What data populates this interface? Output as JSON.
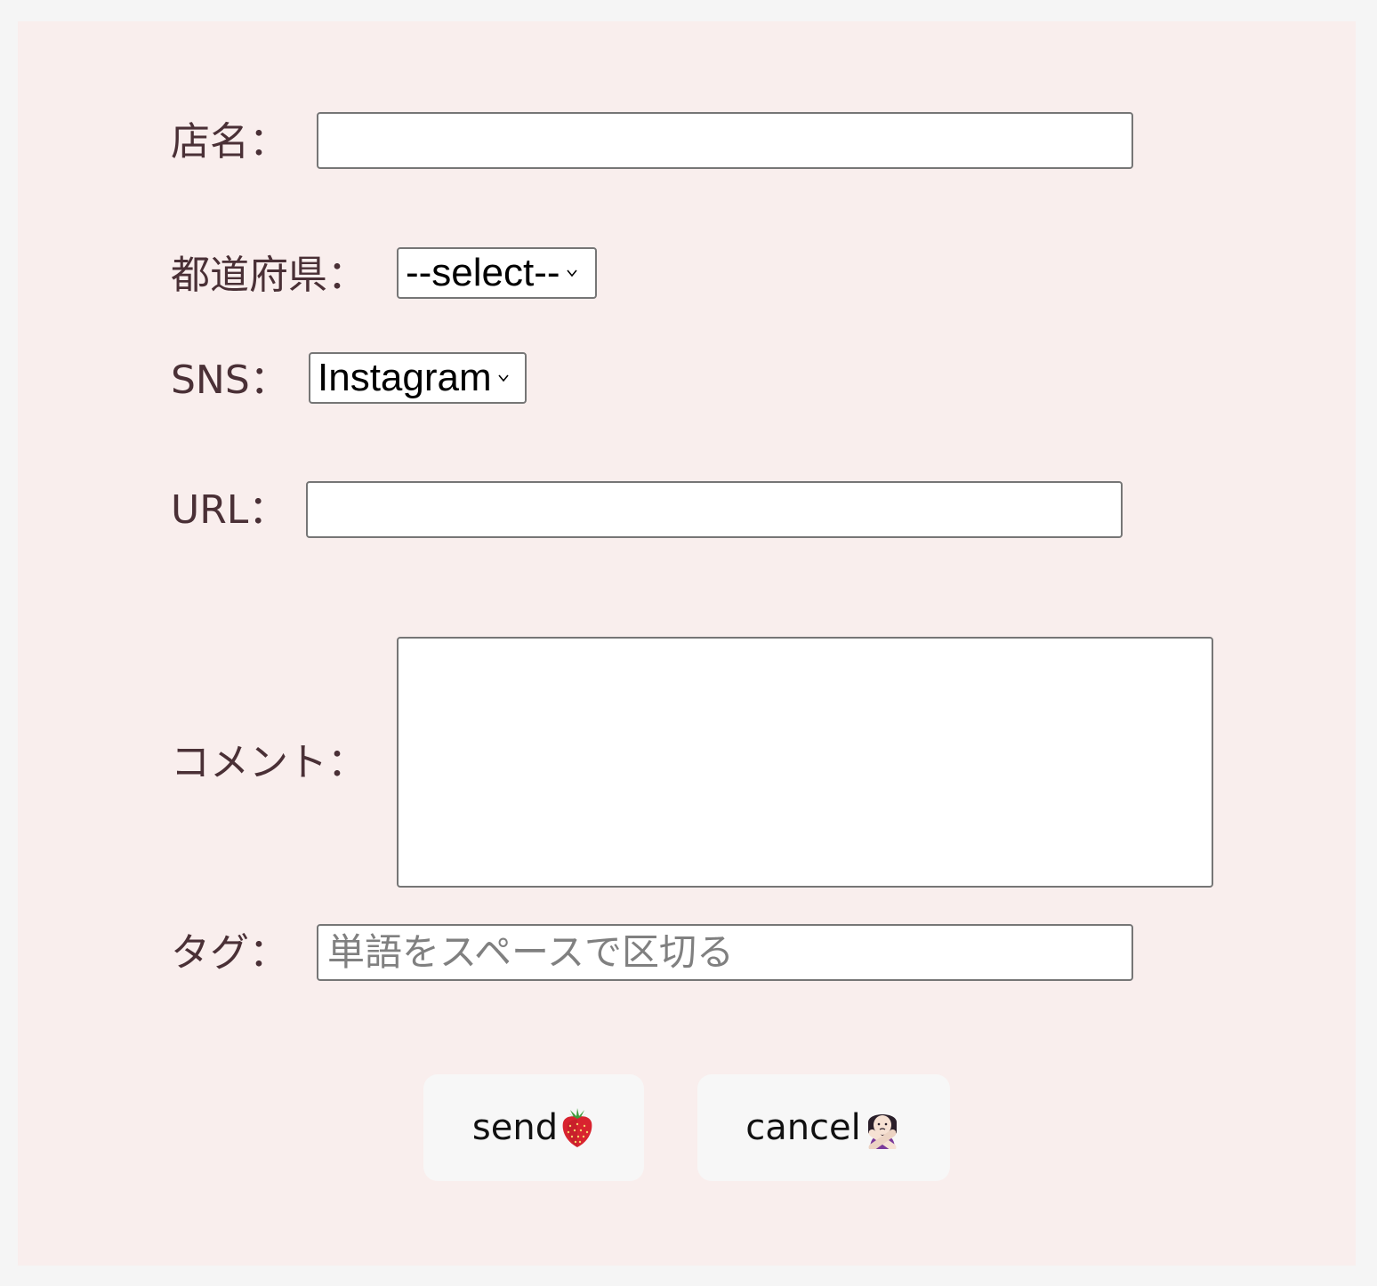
{
  "form": {
    "shop_name": {
      "label": "店名：",
      "value": ""
    },
    "prefecture": {
      "label": "都道府県：",
      "selected": "--select--"
    },
    "sns": {
      "label": "SNS：",
      "selected": "Instagram"
    },
    "url": {
      "label": "URL：",
      "value": ""
    },
    "comment": {
      "label": "コメント：",
      "value": ""
    },
    "tags": {
      "label": "タグ：",
      "placeholder": "単語をスペースで区切る",
      "value": ""
    }
  },
  "buttons": {
    "send_label": "send",
    "send_icon": "strawberry-icon",
    "cancel_label": "cancel",
    "cancel_icon": "person-gesturing-no-icon"
  },
  "colors": {
    "page_background": "#f5f5f5",
    "panel_background": "#f9eeed",
    "label_text": "#4a3036",
    "button_background": "#f7f7f7"
  }
}
